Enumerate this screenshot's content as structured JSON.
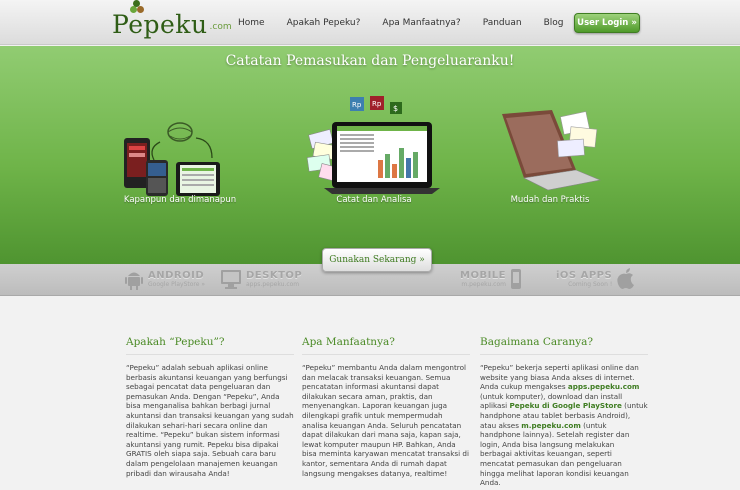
{
  "header": {
    "logo_main": "Pepeku",
    "logo_domain": ".com",
    "nav": [
      "Home",
      "Apakah Pepeku?",
      "Apa Manfaatnya?",
      "Panduan",
      "Blog"
    ],
    "login_label": "User Login »"
  },
  "hero": {
    "title": "Catatan Pemasukan dan Pengeluaranku!",
    "features": [
      {
        "caption": "Kapanpun dan dimanapun",
        "icon": "devices-icon"
      },
      {
        "caption": "Catat dan Analisa",
        "icon": "laptop-chart-icon"
      },
      {
        "caption": "Mudah dan Praktis",
        "icon": "laptop-notes-icon"
      }
    ],
    "currency_tags": [
      "Rp",
      "Rp",
      "$"
    ],
    "cta_label": "Gunakan Sekarang »"
  },
  "platforms": [
    {
      "name": "ANDROID",
      "sub": "Google PlayStore »"
    },
    {
      "name": "DESKTOP",
      "sub": "apps.pepeku.com"
    },
    {
      "name": "MOBILE",
      "sub": "m.pepeku.com"
    },
    {
      "name": "iOS APPS",
      "sub": "Coming Soon !"
    }
  ],
  "columns": [
    {
      "heading": "Apakah “Pepeku”?",
      "text": "“Pepeku” adalah sebuah aplikasi online berbasis akuntansi keuangan yang berfungsi sebagai pencatat data pengeluaran dan pemasukan Anda. Dengan “Pepeku”, Anda bisa menganalisa bahkan berbagi jurnal akuntansi dan transaksi keuangan yang sudah dilakukan sehari-hari secara online dan realtime. “Pepeku” bukan sistem informasi akuntansi yang rumit. Pepeku bisa dipakai GRATIS oleh siapa saja. Sebuah cara baru dalam pengelolaan manajemen keuangan pribadi dan wirausaha Anda!"
    },
    {
      "heading": "Apa Manfaatnya?",
      "text": "“Pepeku” membantu Anda dalam mengontrol dan melacak transaksi keuangan. Semua pencatatan informasi akuntansi dapat dilakukan secara aman, praktis, dan menyenangkan. Laporan keuangan juga dilengkapi grafik untuk mempermudah analisa keuangan Anda. Seluruh pencatatan dapat dilakukan dari mana saja, kapan saja, lewat komputer maupun HP. Bahkan, Anda bisa meminta karyawan mencatat transaksi di kantor, sementara Anda di rumah dapat langsung mengakses datanya, realtime!"
    },
    {
      "heading": "Bagaimana Caranya?",
      "text_parts": [
        "“Pepeku” bekerja seperti aplikasi online dan website yang biasa Anda akses di internet. Anda cukup mengakses ",
        "apps.pepeku.com",
        " (untuk komputer), download dan install aplikasi ",
        "Pepeku di Google PlayStore",
        " (untuk handphone atau tablet berbasis Android), atau akses ",
        "m.pepeku.com",
        " (untuk handphone lainnya). Setelah register dan login, Anda bisa langsung melakukan berbagai aktivitas keuangan, seperti mencatat pemasukan dan pengeluaran hingga melihat laporan kondisi keuangan Anda."
      ]
    }
  ],
  "colors": {
    "brand_green": "#4a8a25",
    "hero_top": "#91cc72",
    "hero_bottom": "#4f9430"
  }
}
